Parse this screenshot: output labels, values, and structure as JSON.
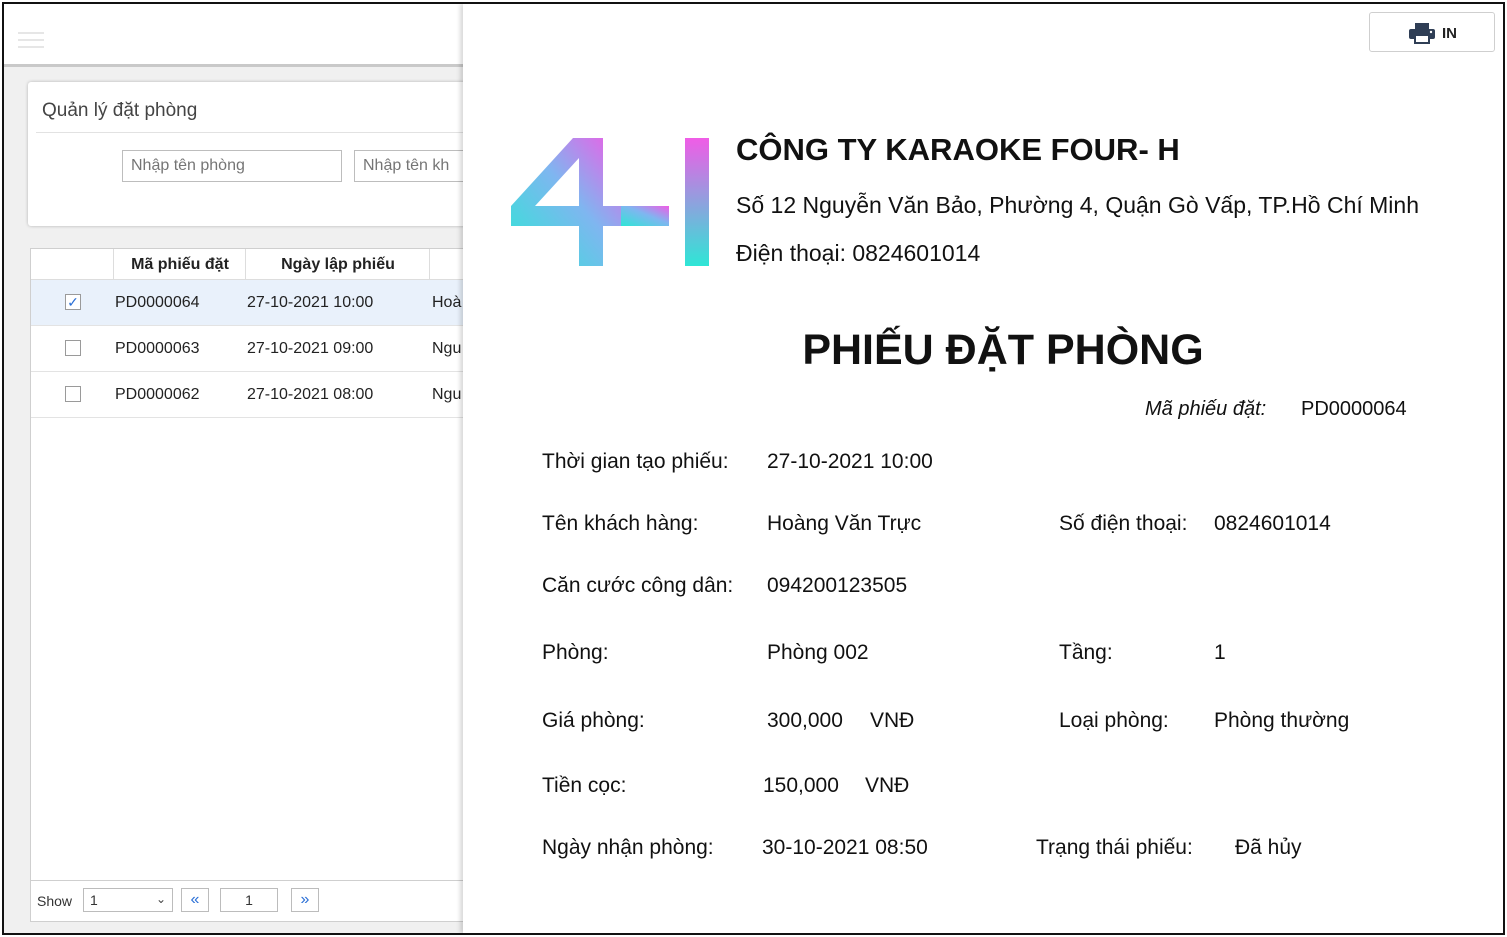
{
  "app": {
    "section_title": "Quản lý đặt phòng",
    "search": {
      "room_placeholder": "Nhập tên phòng",
      "customer_placeholder": "Nhập tên kh"
    },
    "table": {
      "headers": [
        "Mã phiếu đặt",
        "Ngày lập phiếu"
      ],
      "rows": [
        {
          "checked": true,
          "code": "PD0000064",
          "date": "27-10-2021 10:00",
          "customer": "Hoà"
        },
        {
          "checked": false,
          "code": "PD0000063",
          "date": "27-10-2021 09:00",
          "customer": "Ngu"
        },
        {
          "checked": false,
          "code": "PD0000062",
          "date": "27-10-2021 08:00",
          "customer": "Ngu"
        }
      ]
    },
    "pager": {
      "show_label": "Show",
      "page_size": "1",
      "current_page": "1",
      "prev_icon": "«",
      "next_icon": "»"
    }
  },
  "document": {
    "print_label": "IN",
    "company_name": "CÔNG TY KARAOKE FOUR- H",
    "address": "Số 12 Nguyễn Văn Bảo, Phường 4, Quận Gò Vấp, TP.Hồ Chí Minh",
    "phone_line": "Điện thoại: 0824601014",
    "title": "PHIẾU ĐẶT PHÒNG",
    "code_label": "Mã phiếu đặt:",
    "code_value": "PD0000064",
    "fields": {
      "created_label": "Thời gian tạo phiếu:",
      "created_value": "27-10-2021 10:00",
      "customer_label": "Tên khách hàng:",
      "customer_value": "Hoàng Văn Trực",
      "phone_label": "Số điện thoại:",
      "phone_value": "0824601014",
      "id_label": "Căn cước công dân:",
      "id_value": "094200123505",
      "room_label": "Phòng:",
      "room_value": "Phòng 002",
      "floor_label": "Tầng:",
      "floor_value": "1",
      "price_label": "Giá phòng:",
      "price_value": "300,000",
      "price_unit": "VNĐ",
      "room_type_label": "Loại phòng:",
      "room_type_value": "Phòng thường",
      "deposit_label": "Tiền cọc:",
      "deposit_value": "150,000",
      "deposit_unit": "VNĐ",
      "checkin_label": "Ngày nhận phòng:",
      "checkin_value": "30-10-2021 08:50",
      "status_label": "Trạng thái phiếu:",
      "status_value": "Đã hủy"
    },
    "logo_text": "4I"
  },
  "colors": {
    "accent": "#2a6fd6",
    "logo_cyan": "#2ee6d6",
    "logo_magenta": "#f05ce6",
    "selected_row": "#e9f1fb"
  }
}
